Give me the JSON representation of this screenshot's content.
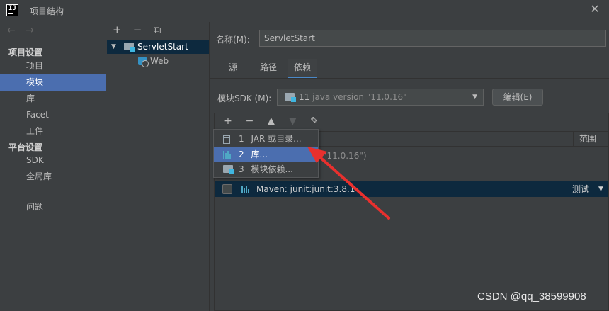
{
  "window": {
    "title": "项目结构",
    "app_icon_text": "IJ",
    "close_glyph": "✕"
  },
  "sidebar": {
    "nav_back": "←",
    "nav_forward": "→",
    "project_settings": "项目设置",
    "platform_settings": "平台设置",
    "items": [
      {
        "label": "项目"
      },
      {
        "label": "模块"
      },
      {
        "label": "库"
      },
      {
        "label": "Facet"
      },
      {
        "label": "工件"
      },
      {
        "label": "SDK"
      },
      {
        "label": "全局库"
      },
      {
        "label": "问题"
      }
    ],
    "selected": "模块"
  },
  "module_tree": {
    "toolbar": [
      "+",
      "−",
      "⧉"
    ],
    "expand_glyph": "▼",
    "root": "ServletStart",
    "child": "Web"
  },
  "module": {
    "name_label": "名称(M):",
    "name_value": "ServletStart",
    "tabs": [
      {
        "label": "源"
      },
      {
        "label": "路径"
      },
      {
        "label": "依赖"
      }
    ],
    "active_tab": "依赖",
    "sdk_label": "模块SDK (M):",
    "sdk_value": "11",
    "sdk_version": "java version \"11.0.16\"",
    "combo_arrow": "▼",
    "edit_button": "编辑(E)",
    "dep_toolbar": [
      "+",
      "−",
      "▲",
      "▼",
      "✎"
    ],
    "scope_header": "范围",
    "sdk_row_text": "\"11.0.16\")",
    "dependency": {
      "label": "Maven: junit:junit:3.8.1",
      "scope": "测试",
      "scope_arrow": "▼",
      "checked": false
    }
  },
  "popup": {
    "items": [
      {
        "num": "1",
        "label": "JAR 或目录...",
        "icon": "jar-icon"
      },
      {
        "num": "2",
        "label": "库...",
        "icon": "library-icon"
      },
      {
        "num": "3",
        "label": "模块依赖...",
        "icon": "module-icon"
      }
    ],
    "selected": "库..."
  },
  "annotation": {
    "arrow_color": "#e8302e"
  },
  "watermark": "CSDN @qq_38599908"
}
